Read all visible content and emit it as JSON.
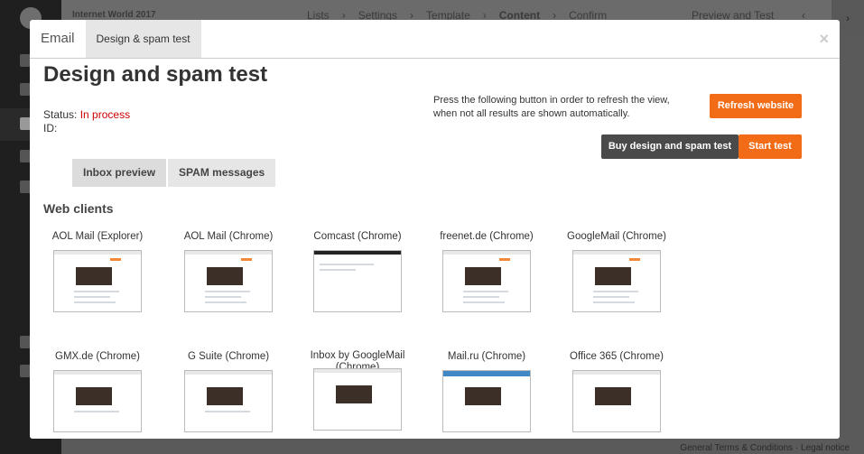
{
  "app": {
    "project": "Internet World 2017",
    "breadcrumbs": [
      "Lists",
      "Settings",
      "Template",
      "Content",
      "Confirm"
    ],
    "current_step": "Content",
    "preview_tab": "Preview and Test",
    "footer": "General Terms & Conditions · Legal notice"
  },
  "modal": {
    "tabs": [
      "Email",
      "Design & spam test"
    ],
    "active_tab": "Design & spam test",
    "close_icon": "×",
    "title": "Design and spam test",
    "status_label": "Status:",
    "status_value": "In process",
    "id_label": "ID:",
    "refresh_note": "Press the following button in order to refresh the view, when not all results are shown automatically.",
    "refresh_button": "Refresh website",
    "buy_button": "Buy design and spam test",
    "start_button": "Start test",
    "subtabs": [
      "Inbox preview",
      "SPAM messages"
    ],
    "section_title": "Web clients",
    "clients": [
      "AOL Mail (Explorer)",
      "AOL Mail (Chrome)",
      "Comcast (Chrome)",
      "freenet.de (Chrome)",
      "GoogleMail (Chrome)",
      "GMX.de (Chrome)",
      "G Suite (Chrome)",
      "Inbox by GoogleMail (Chrome)",
      "Mail.ru (Chrome)",
      "Office 365 (Chrome)"
    ],
    "colors": {
      "accent": "#f26b17",
      "dark_button": "#4a4a4a",
      "status": "#cc0000"
    }
  }
}
